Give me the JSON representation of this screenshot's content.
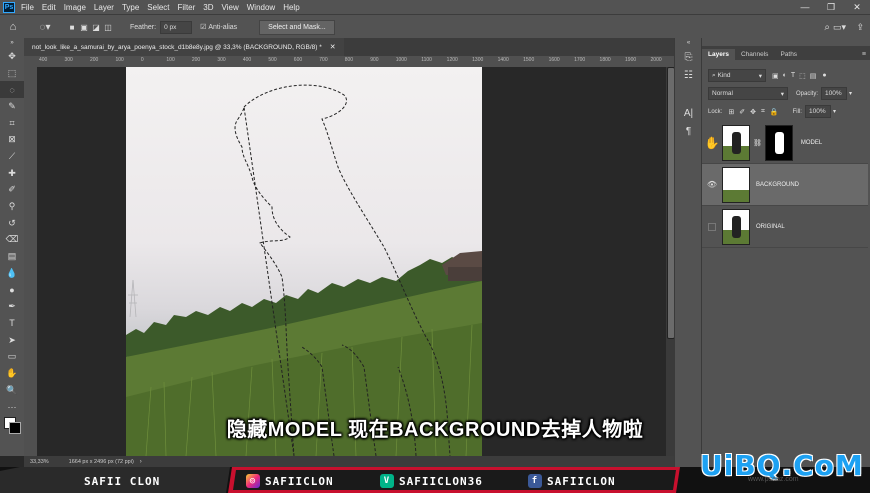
{
  "menu": {
    "app_icon": "Ps",
    "items": [
      "File",
      "Edit",
      "Image",
      "Layer",
      "Type",
      "Select",
      "Filter",
      "3D",
      "View",
      "Window",
      "Help"
    ],
    "window_controls": [
      "—",
      "❐",
      "✕"
    ]
  },
  "options": {
    "feather_label": "Feather:",
    "feather_value": "0 px",
    "antialias_label": "Anti-alias",
    "select_mask_label": "Select and Mask..."
  },
  "document": {
    "tab_title": "not_look_like_a_samurai_by_arya_poenya_stock_d1b8e8y.jpg @ 33,3% (BACKGROUND, RGB/8) *",
    "zoom": "33,33%",
    "size_info": "1664 px x 2496 px (72 ppi)",
    "ruler_marks": [
      "400",
      "300",
      "200",
      "100",
      "0",
      "100",
      "200",
      "300",
      "400",
      "500",
      "600",
      "700",
      "800",
      "900",
      "1000",
      "1100",
      "1200",
      "1300",
      "1400",
      "1500",
      "1600",
      "1700",
      "1800",
      "1900",
      "2000"
    ]
  },
  "layers_panel": {
    "tabs": [
      "Layers",
      "Channels",
      "Paths"
    ],
    "kind_label": "Kind",
    "blend_mode": "Normal",
    "opacity_label": "Opacity:",
    "opacity_value": "100%",
    "lock_label": "Lock:",
    "fill_label": "Fill:",
    "fill_value": "100%",
    "layers": [
      {
        "name": "MODEL",
        "visible": false,
        "selected": false
      },
      {
        "name": "BACKGROUND",
        "visible": true,
        "selected": true
      },
      {
        "name": "ORIGINAL",
        "visible": false,
        "selected": false
      }
    ]
  },
  "subtitle": "隐藏MODEL 现在BACKGROUND去掉人物啦",
  "banner": {
    "brand": "SAFII CLON",
    "instagram": "SAFIICLON",
    "vine": "SAFIICLON36",
    "facebook": "SAFIICLON",
    "watermark": "UiBQ.CoM",
    "watermark_sub": "www.psahz.com"
  },
  "colors": {
    "accent": "#31a8ff",
    "banner_red": "#c8102e",
    "watermark_blue": "#1da1f2"
  }
}
